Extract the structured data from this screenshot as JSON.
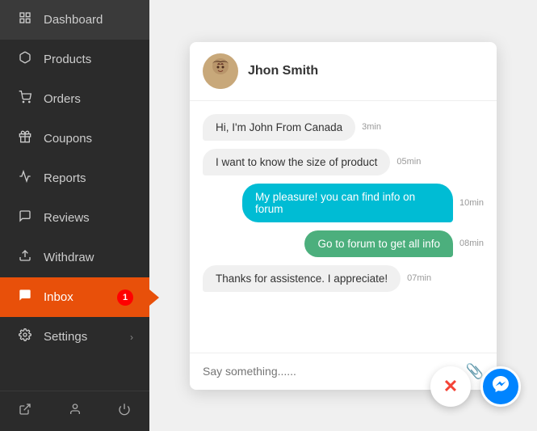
{
  "sidebar": {
    "items": [
      {
        "id": "dashboard",
        "label": "Dashboard",
        "icon": "grid"
      },
      {
        "id": "products",
        "label": "Products",
        "icon": "box"
      },
      {
        "id": "orders",
        "label": "Orders",
        "icon": "cart"
      },
      {
        "id": "coupons",
        "label": "Coupons",
        "icon": "gift"
      },
      {
        "id": "reports",
        "label": "Reports",
        "icon": "chart"
      },
      {
        "id": "reviews",
        "label": "Reviews",
        "icon": "bubble"
      },
      {
        "id": "withdraw",
        "label": "Withdraw",
        "icon": "upload"
      },
      {
        "id": "inbox",
        "label": "Inbox",
        "icon": "chat",
        "active": true,
        "badge": "1"
      },
      {
        "id": "settings",
        "label": "Settings",
        "icon": "gear",
        "hasChevron": true
      }
    ],
    "bottom": [
      {
        "id": "external",
        "icon": "external"
      },
      {
        "id": "user",
        "icon": "user"
      },
      {
        "id": "power",
        "icon": "power"
      }
    ]
  },
  "chat": {
    "header": {
      "name": "Jhon Smith"
    },
    "messages": [
      {
        "id": 1,
        "type": "received",
        "style": "received",
        "text": "Hi, I'm John From Canada",
        "time": "3min"
      },
      {
        "id": 2,
        "type": "received",
        "style": "received",
        "text": "I want to know the size of product",
        "time": "05min"
      },
      {
        "id": 3,
        "type": "sent",
        "style": "sent-teal",
        "text": "My pleasure! you can find info on forum",
        "time": "10min"
      },
      {
        "id": 4,
        "type": "sent",
        "style": "sent-green",
        "text": "Go to forum to get all info",
        "time": "08min"
      },
      {
        "id": 5,
        "type": "received",
        "style": "received",
        "text": "Thanks for assistence. I appreciate!",
        "time": "07min"
      }
    ],
    "input_placeholder": "Say something......",
    "attach_icon": "📎"
  },
  "floating": {
    "close_icon": "✕",
    "messenger_icon": "💬"
  }
}
